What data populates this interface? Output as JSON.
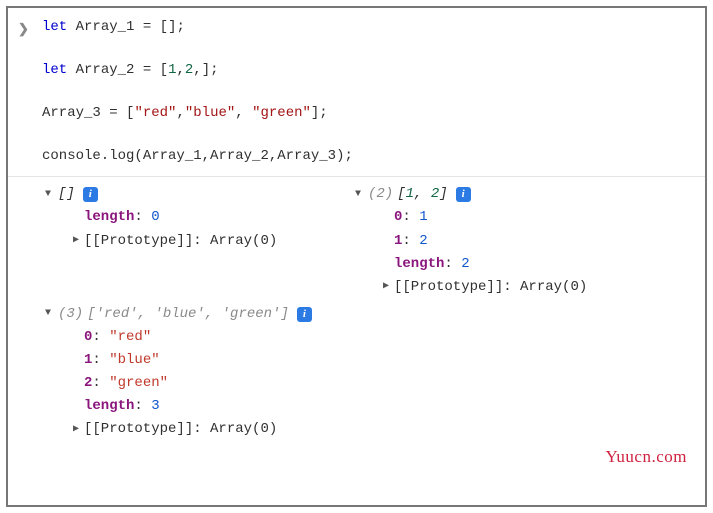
{
  "input": {
    "lines": [
      {
        "type": "let-empty",
        "keyword": "let",
        "ident": "Array_1",
        "rhs_open": "[",
        "rhs_close": "];"
      },
      {
        "type": "let-nums",
        "keyword": "let",
        "ident": "Array_2",
        "rhs_open": "[",
        "nums": [
          "1",
          "2"
        ],
        "trail": ",",
        "rhs_close": "];"
      },
      {
        "type": "assign-strs",
        "ident": "Array_3",
        "rhs_open": "[",
        "strs": [
          "\"red\"",
          "\"blue\"",
          "\"green\""
        ],
        "rhs_close": "];"
      },
      {
        "type": "call",
        "text_pre": "console.log(",
        "args": "Array_1,Array_2,Array_3",
        "text_post": ");"
      }
    ]
  },
  "output": {
    "array1": {
      "summary": "[]",
      "length_label": "length",
      "length_value": "0",
      "proto_label": "[[Prototype]]",
      "proto_value": "Array(0)"
    },
    "array2": {
      "count": "(2)",
      "summary": "[1, 2]",
      "items": [
        {
          "key": "0",
          "value": "1"
        },
        {
          "key": "1",
          "value": "2"
        }
      ],
      "length_label": "length",
      "length_value": "2",
      "proto_label": "[[Prototype]]",
      "proto_value": "Array(0)"
    },
    "array3": {
      "count": "(3)",
      "summary": "['red', 'blue', 'green']",
      "items": [
        {
          "key": "0",
          "value": "\"red\""
        },
        {
          "key": "1",
          "value": "\"blue\""
        },
        {
          "key": "2",
          "value": "\"green\""
        }
      ],
      "length_label": "length",
      "length_value": "3",
      "proto_label": "[[Prototype]]",
      "proto_value": "Array(0)"
    }
  },
  "watermark": "Yuucn.com"
}
